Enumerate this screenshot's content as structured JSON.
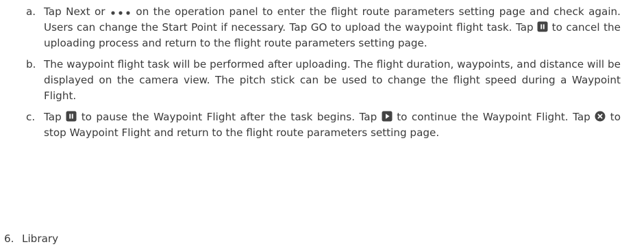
{
  "items": [
    {
      "marker": "a.",
      "parts": [
        "Tap Next or",
        "on the operation panel to enter the flight route parameters setting page and check again. Users can change the Start Point if necessary. Tap GO to upload the waypoint flight task. Tap",
        "to cancel the uploading process and return to the flight route parameters setting page."
      ]
    },
    {
      "marker": "b.",
      "text": "The waypoint flight task will be performed after uploading. The flight duration, waypoints, and distance will be displayed on the camera view. The pitch stick can be used to change the flight speed during a Waypoint Flight."
    },
    {
      "marker": "c.",
      "parts": [
        "Tap",
        "to pause the Waypoint Flight after the task begins. Tap",
        "to continue the Waypoint Flight. Tap",
        "to stop Waypoint Flight and return to the flight route parameters setting page."
      ]
    }
  ],
  "section": {
    "number": "6.",
    "title": "Library"
  },
  "icons": {
    "more": "more-dots-icon",
    "pause": "pause-icon",
    "play": "play-icon",
    "stop": "stop-circle-icon"
  },
  "colors": {
    "text": "#3a3a3a",
    "icon": "#444444"
  }
}
